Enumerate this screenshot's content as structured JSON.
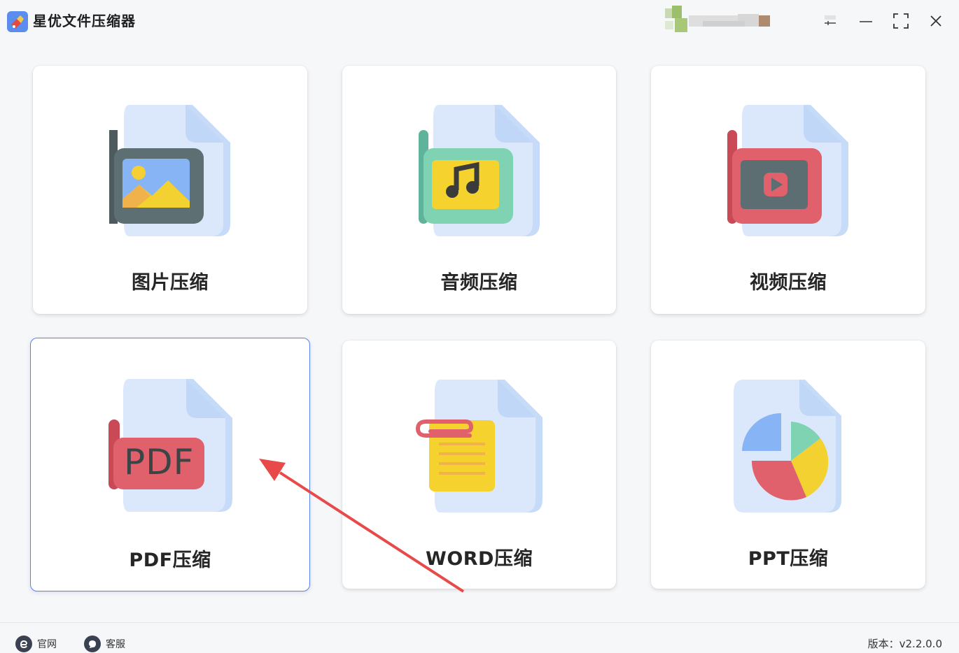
{
  "app": {
    "title": "星优文件压缩器"
  },
  "cards": [
    {
      "label": "图片压缩",
      "icon": "image-file-icon"
    },
    {
      "label": "音频压缩",
      "icon": "audio-file-icon"
    },
    {
      "label": "视频压缩",
      "icon": "video-file-icon"
    },
    {
      "label": "PDF压缩",
      "icon": "pdf-file-icon",
      "icon_text": "PDF",
      "selected": true
    },
    {
      "label": "WORD压缩",
      "icon": "word-file-icon"
    },
    {
      "label": "PPT压缩",
      "icon": "ppt-file-icon"
    }
  ],
  "footer": {
    "website_label": "官网",
    "support_label": "客服",
    "version_text": "版本：v2.2.0.0"
  },
  "colors": {
    "accent": "#5b7ff0",
    "arrow": "#e84a4a"
  }
}
